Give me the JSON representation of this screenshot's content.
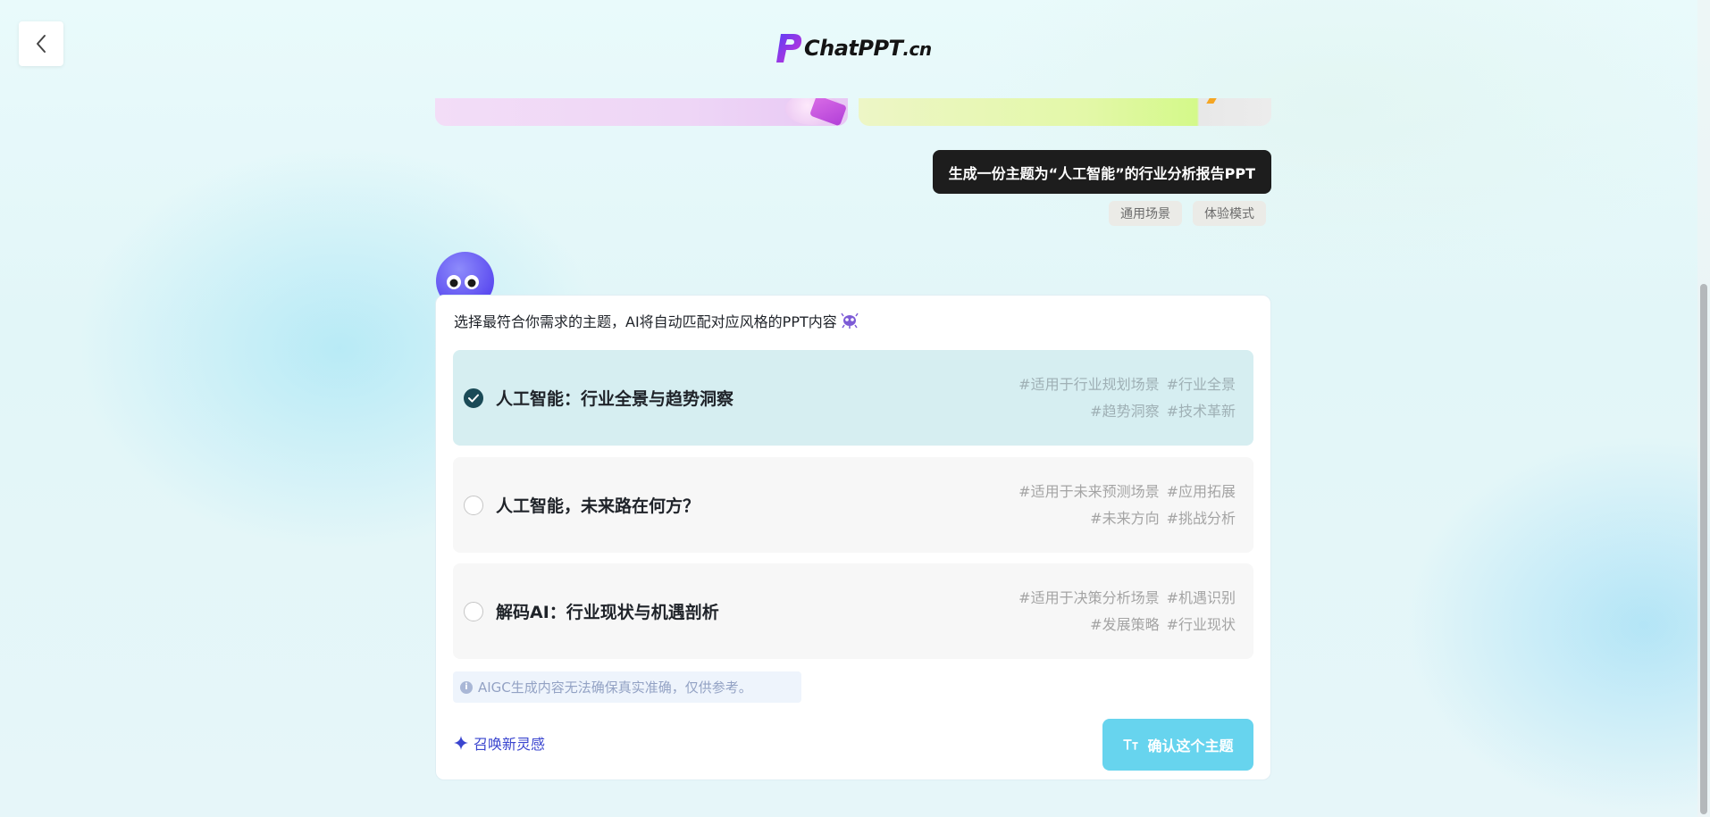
{
  "header": {
    "logo_text": "ChatPPT",
    "logo_suffix": ".cn"
  },
  "conversation": {
    "user_message": "生成一份主题为“人工智能”的行业分析报告PPT",
    "tags": [
      "通用场景",
      "体验模式"
    ]
  },
  "card": {
    "intro": "选择最符合你需求的主题，AI将自动匹配对应风格的PPT内容",
    "options": [
      {
        "title": "人工智能：行业全景与趋势洞察",
        "selected": true,
        "tags": [
          "#适用于行业规划场景",
          "#行业全景",
          "#趋势洞察",
          "#技术革新"
        ]
      },
      {
        "title": "人工智能，未来路在何方？",
        "selected": false,
        "tags": [
          "#适用于未来预测场景",
          "#应用拓展",
          "#未来方向",
          "#挑战分析"
        ]
      },
      {
        "title": "解码AI：行业现状与机遇剖析",
        "selected": false,
        "tags": [
          "#适用于决策分析场景",
          "#机遇识别",
          "#发展策略",
          "#行业现状"
        ]
      }
    ],
    "notice": "AIGC生成内容无法确保真实准确，仅供参考。",
    "inspire_label": "召唤新灵感",
    "confirm_label": "确认这个主题"
  },
  "colors": {
    "accent": "#67d4ee",
    "selected_bg": "#d6eef1",
    "check": "#1a4a57",
    "link": "#3a45cf",
    "user_bubble": "#1d1d1d"
  }
}
